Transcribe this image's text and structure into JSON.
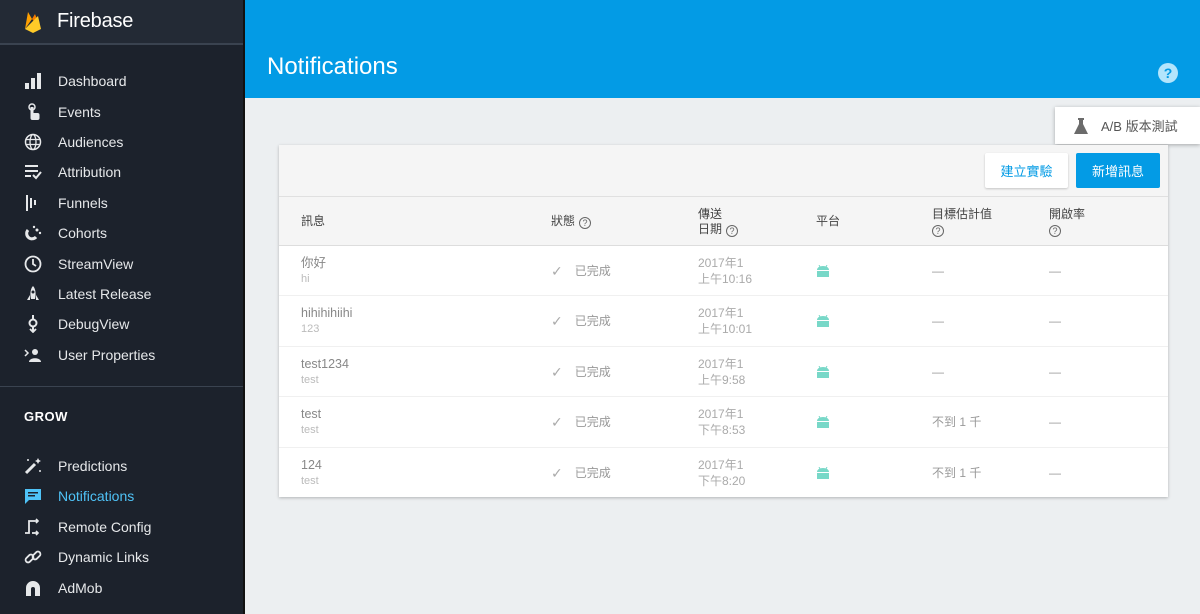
{
  "app": {
    "name": "Firebase"
  },
  "sidebar": {
    "analytics_items": [
      {
        "label": "Dashboard",
        "icon": "bar-chart-icon"
      },
      {
        "label": "Events",
        "icon": "touch-icon"
      },
      {
        "label": "Audiences",
        "icon": "globe-icon"
      },
      {
        "label": "Attribution",
        "icon": "list-check-icon"
      },
      {
        "label": "Funnels",
        "icon": "funnel-bars-icon"
      },
      {
        "label": "Cohorts",
        "icon": "magnet-icon"
      },
      {
        "label": "StreamView",
        "icon": "clock-icon"
      },
      {
        "label": "Latest Release",
        "icon": "rocket-icon"
      },
      {
        "label": "DebugView",
        "icon": "debug-icon"
      },
      {
        "label": "User Properties",
        "icon": "user-properties-icon"
      }
    ],
    "grow_section": "GROW",
    "grow_items": [
      {
        "label": "Predictions",
        "icon": "magic-wand-icon"
      },
      {
        "label": "Notifications",
        "icon": "chat-icon",
        "active": true
      },
      {
        "label": "Remote Config",
        "icon": "remote-config-icon"
      },
      {
        "label": "Dynamic Links",
        "icon": "link-icon"
      },
      {
        "label": "AdMob",
        "icon": "admob-icon"
      }
    ]
  },
  "header": {
    "title": "Notifications",
    "help_icon": "?"
  },
  "ab_popup": {
    "label": "A/B 版本測試"
  },
  "toolbar": {
    "create_experiment": "建立實驗",
    "new_message": "新增訊息"
  },
  "table": {
    "columns": {
      "message": "訊息",
      "status": "狀態",
      "date_line1": "傳送",
      "date_line2": "日期",
      "platform": "平台",
      "target": "目標估計值",
      "open_rate": "開啟率"
    },
    "rows": [
      {
        "title": "你好",
        "subtitle": "hi",
        "status": "已完成",
        "date": "2017年1",
        "time": "上午10:16",
        "platform": "android",
        "target": "—",
        "open_rate": "—"
      },
      {
        "title": "hihihihiihi",
        "subtitle": "123",
        "status": "已完成",
        "date": "2017年1",
        "time": "上午10:01",
        "platform": "android",
        "target": "—",
        "open_rate": "—"
      },
      {
        "title": "test1234",
        "subtitle": "test",
        "status": "已完成",
        "date": "2017年1",
        "time": "上午9:58",
        "platform": "android",
        "target": "—",
        "open_rate": "—"
      },
      {
        "title": "test",
        "subtitle": "test",
        "status": "已完成",
        "date": "2017年1",
        "time": "下午8:53",
        "platform": "android",
        "target": "不到 1 千",
        "open_rate": "—"
      },
      {
        "title": "124",
        "subtitle": "test",
        "status": "已完成",
        "date": "2017年1",
        "time": "下午8:20",
        "platform": "android",
        "target": "不到 1 千",
        "open_rate": "—"
      }
    ]
  },
  "colors": {
    "accent": "#039be5",
    "sidebar_bg": "#1c222c",
    "active_nav": "#4fc3f7",
    "android": "#78d8c8"
  }
}
